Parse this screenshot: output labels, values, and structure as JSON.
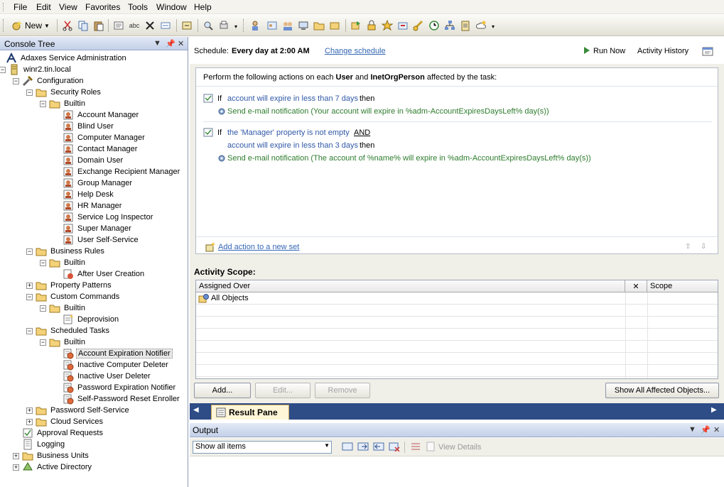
{
  "menu": [
    "File",
    "Edit",
    "View",
    "Favorites",
    "Tools",
    "Window",
    "Help"
  ],
  "toolbar": {
    "new_label": "New"
  },
  "tree": {
    "title": "Console Tree",
    "items": [
      {
        "label": "Adaxes Service Administration",
        "icon": "adaxes-logo-icon",
        "level": 0
      },
      {
        "label": "winr2.tin.local",
        "icon": "server-icon",
        "level": 1,
        "expander": "-"
      },
      {
        "label": "Configuration",
        "icon": "tools-icon",
        "level": 2,
        "expander": "-"
      },
      {
        "label": "Security Roles",
        "icon": "folder-icon",
        "level": 3,
        "expander": "-"
      },
      {
        "label": "Builtin",
        "icon": "folder-icon",
        "level": 4,
        "expander": "-"
      },
      {
        "label": "Account Manager",
        "icon": "role-icon",
        "level": 5
      },
      {
        "label": "Blind User",
        "icon": "role-icon",
        "level": 5
      },
      {
        "label": "Computer Manager",
        "icon": "role-icon",
        "level": 5
      },
      {
        "label": "Contact Manager",
        "icon": "role-icon",
        "level": 5
      },
      {
        "label": "Domain User",
        "icon": "role-icon",
        "level": 5
      },
      {
        "label": "Exchange Recipient Manager",
        "icon": "role-icon",
        "level": 5
      },
      {
        "label": "Group Manager",
        "icon": "role-icon",
        "level": 5
      },
      {
        "label": "Help Desk",
        "icon": "role-icon",
        "level": 5
      },
      {
        "label": "HR Manager",
        "icon": "role-icon",
        "level": 5
      },
      {
        "label": "Service Log Inspector",
        "icon": "role-icon",
        "level": 5
      },
      {
        "label": "Super Manager",
        "icon": "role-icon",
        "level": 5
      },
      {
        "label": "User Self-Service",
        "icon": "role-icon",
        "level": 5
      },
      {
        "label": "Business Rules",
        "icon": "folder-icon",
        "level": 3,
        "expander": "-"
      },
      {
        "label": "Builtin",
        "icon": "folder-icon",
        "level": 4,
        "expander": "-"
      },
      {
        "label": "After User Creation",
        "icon": "rule-icon",
        "level": 5
      },
      {
        "label": "Property Patterns",
        "icon": "folder-icon",
        "level": 3,
        "expander": "+"
      },
      {
        "label": "Custom Commands",
        "icon": "folder-icon",
        "level": 3,
        "expander": "-"
      },
      {
        "label": "Builtin",
        "icon": "folder-icon",
        "level": 4,
        "expander": "-"
      },
      {
        "label": "Deprovision",
        "icon": "command-icon",
        "level": 5
      },
      {
        "label": "Scheduled Tasks",
        "icon": "folder-icon",
        "level": 3,
        "expander": "-"
      },
      {
        "label": "Builtin",
        "icon": "folder-icon",
        "level": 4,
        "expander": "-"
      },
      {
        "label": "Account Expiration Notifier",
        "icon": "task-icon",
        "level": 5,
        "selected": true
      },
      {
        "label": "Inactive Computer Deleter",
        "icon": "task-icon",
        "level": 5
      },
      {
        "label": "Inactive User Deleter",
        "icon": "task-icon",
        "level": 5
      },
      {
        "label": "Password Expiration Notifier",
        "icon": "task-icon",
        "level": 5
      },
      {
        "label": "Self-Password Reset Enroller",
        "icon": "task-icon",
        "level": 5
      },
      {
        "label": "Password Self-Service",
        "icon": "folder-icon",
        "level": 3,
        "expander": "+"
      },
      {
        "label": "Cloud Services",
        "icon": "folder-icon",
        "level": 3,
        "expander": "+"
      },
      {
        "label": "Approval Requests",
        "icon": "approval-icon",
        "level": 2
      },
      {
        "label": "Logging",
        "icon": "log-icon",
        "level": 2
      },
      {
        "label": "Business Units",
        "icon": "folder-icon",
        "level": 2,
        "expander": "+"
      },
      {
        "label": "Active Directory",
        "icon": "directory-icon",
        "level": 2,
        "expander": "+"
      }
    ]
  },
  "schedule": {
    "label": "Schedule:",
    "value": "Every day at 2:00 AM",
    "change_link": "Change schedule",
    "run_now": "Run Now",
    "activity_history": "Activity History"
  },
  "actions": {
    "header_prefix": "Perform the following actions on each",
    "obj1": "User",
    "and": "and",
    "obj2": "InetOrgPerson",
    "header_suffix": "affected by the task:",
    "if": "If",
    "then": "then",
    "set1_condition": "account will expire in less than 7 days",
    "set1_action": "Send e-mail notification (Your account will expire in %adm-AccountExpiresDaysLeft% day(s))",
    "set2_condition1": "the 'Manager' property is not empty",
    "set2_and": "AND",
    "set2_condition2": "account will expire in less than 3 days",
    "set2_action": "Send e-mail notification (The account of %name% will expire in %adm-AccountExpiresDaysLeft% day(s))",
    "add_link": "Add action to a new set"
  },
  "scope": {
    "title": "Activity Scope:",
    "col_assigned": "Assigned Over",
    "col_x": "✕",
    "col_scope": "Scope",
    "rows": [
      {
        "assigned": "All Objects",
        "scope": ""
      }
    ],
    "buttons": {
      "add": "Add...",
      "edit": "Edit...",
      "remove": "Remove",
      "show_all": "Show All Affected Objects..."
    }
  },
  "tabs": {
    "result_pane": "Result Pane"
  },
  "output": {
    "title": "Output",
    "filter": "Show all items",
    "view_details": "View Details"
  },
  "colors": {
    "tab_bar": "#2e4c86",
    "condition": "#3159a8",
    "action": "#2e7c2e",
    "link": "#3466b5"
  }
}
